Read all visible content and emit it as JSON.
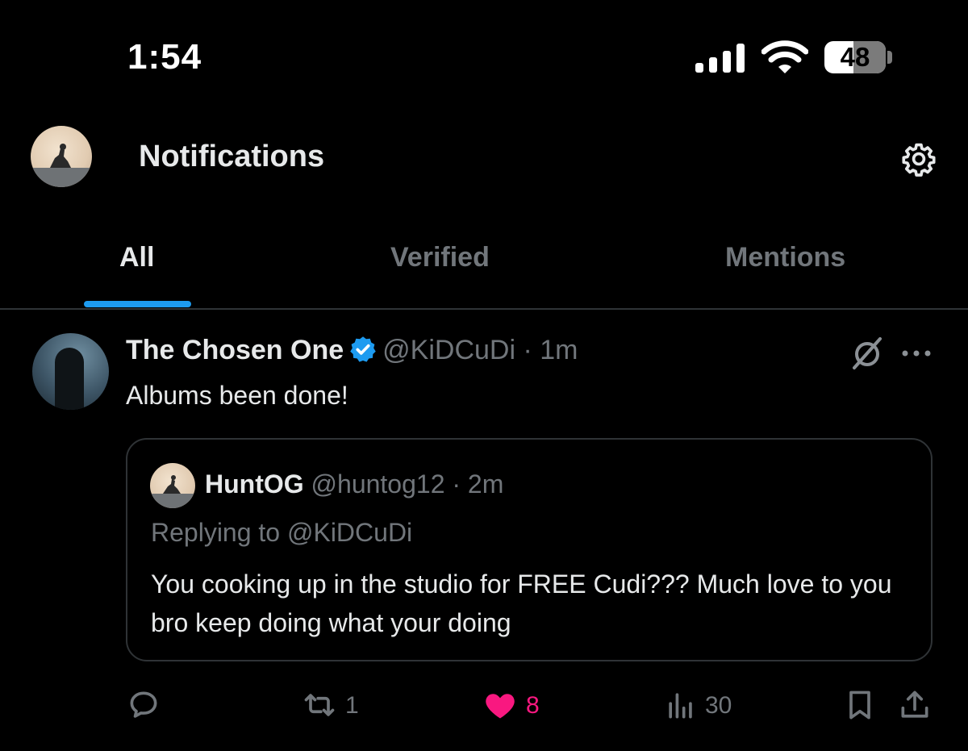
{
  "status_bar": {
    "time": "1:54",
    "battery": "48"
  },
  "header": {
    "title": "Notifications"
  },
  "tabs": [
    {
      "label": "All",
      "active": true
    },
    {
      "label": "Verified",
      "active": false
    },
    {
      "label": "Mentions",
      "active": false
    }
  ],
  "tweet": {
    "display_name": "The Chosen One",
    "handle": "@KiDCuDi",
    "separator": "·",
    "time": "1m",
    "text": "Albums been done!",
    "quote": {
      "display_name": "HuntOG",
      "handle": "@huntog12",
      "separator": "·",
      "time": "2m",
      "replying_to": "Replying to @KiDCuDi",
      "text": "You cooking up in the studio for FREE Cudi??? Much love to you bro keep doing what your doing"
    },
    "actions": {
      "reply_count": "",
      "retweet_count": "1",
      "like_count": "8",
      "views_count": "30"
    }
  },
  "colors": {
    "accent": "#1d9bf0",
    "like": "#f91880",
    "muted": "#71767b"
  }
}
